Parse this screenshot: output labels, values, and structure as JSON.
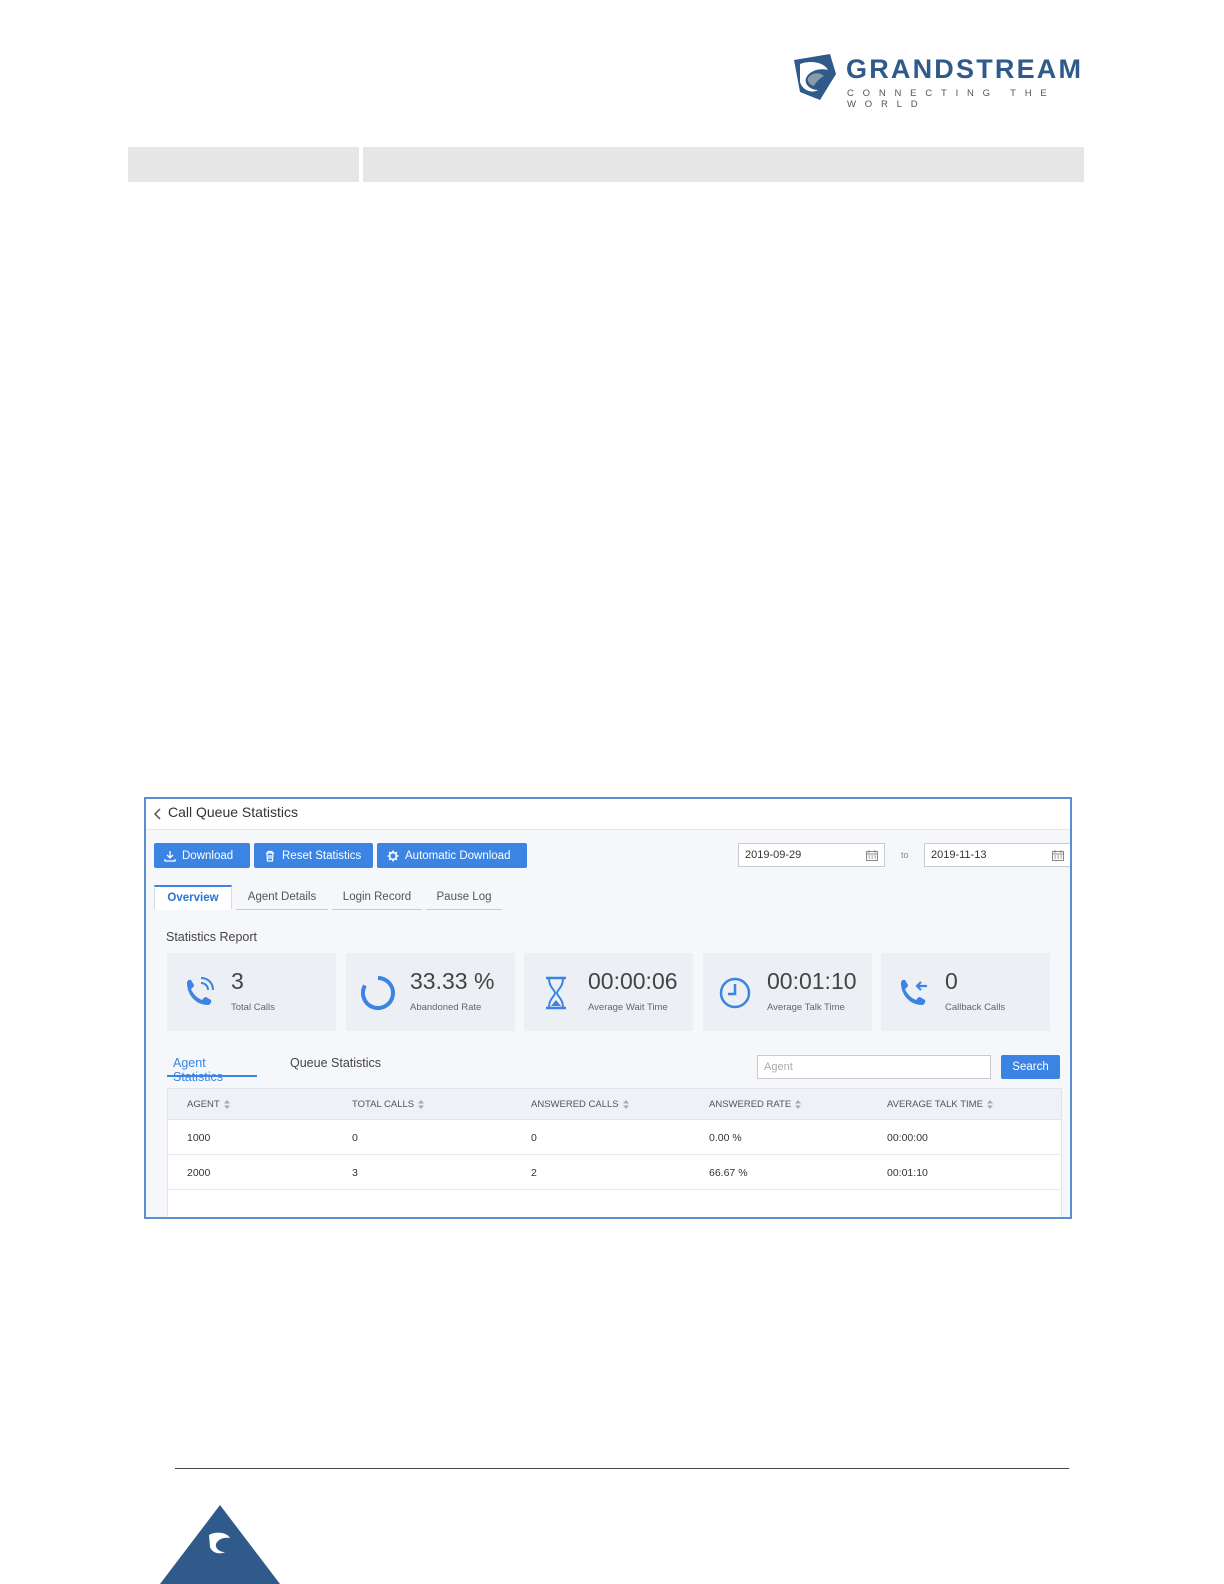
{
  "brand": {
    "name": "GRANDSTREAM",
    "tagline": "CONNECTING THE WORLD",
    "colors": {
      "logo_blue": "#2f5a8a",
      "logo_gray": "#8a9aa8",
      "accent": "#3b84e3"
    }
  },
  "window": {
    "title": "Call Queue Statistics",
    "back_icon": "chevron-left-icon"
  },
  "toolbar": {
    "download_label": "Download",
    "reset_label": "Reset Statistics",
    "auto_download_label": "Automatic Download",
    "date_from": "2019-09-29",
    "to_label": "to",
    "date_to": "2019-11-13"
  },
  "tabs": [
    {
      "label": "Overview",
      "active": true
    },
    {
      "label": "Agent Details",
      "active": false
    },
    {
      "label": "Login Record",
      "active": false
    },
    {
      "label": "Pause Log",
      "active": false
    }
  ],
  "report": {
    "title": "Statistics Report",
    "cards": [
      {
        "value": "3",
        "label": "Total Calls",
        "icon": "phone-ringing-icon"
      },
      {
        "value": "33.33 %",
        "label": "Abandoned Rate",
        "icon": "circular-progress-icon"
      },
      {
        "value": "00:00:06",
        "label": "Average Wait Time",
        "icon": "hourglass-icon"
      },
      {
        "value": "00:01:10",
        "label": "Average Talk Time",
        "icon": "clock-icon"
      },
      {
        "value": "0",
        "label": "Callback Calls",
        "icon": "phone-callback-icon"
      }
    ]
  },
  "subtabs": {
    "agent": "Agent Statistics",
    "queue": "Queue Statistics",
    "search_placeholder": "Agent",
    "search_label": "Search"
  },
  "table": {
    "columns": [
      "AGENT",
      "TOTAL CALLS",
      "ANSWERED CALLS",
      "ANSWERED RATE",
      "AVERAGE TALK TIME"
    ],
    "rows": [
      [
        "1000",
        "0",
        "0",
        "0.00 %",
        "00:00:00"
      ],
      [
        "2000",
        "3",
        "2",
        "66.67 %",
        "00:01:10"
      ]
    ]
  }
}
